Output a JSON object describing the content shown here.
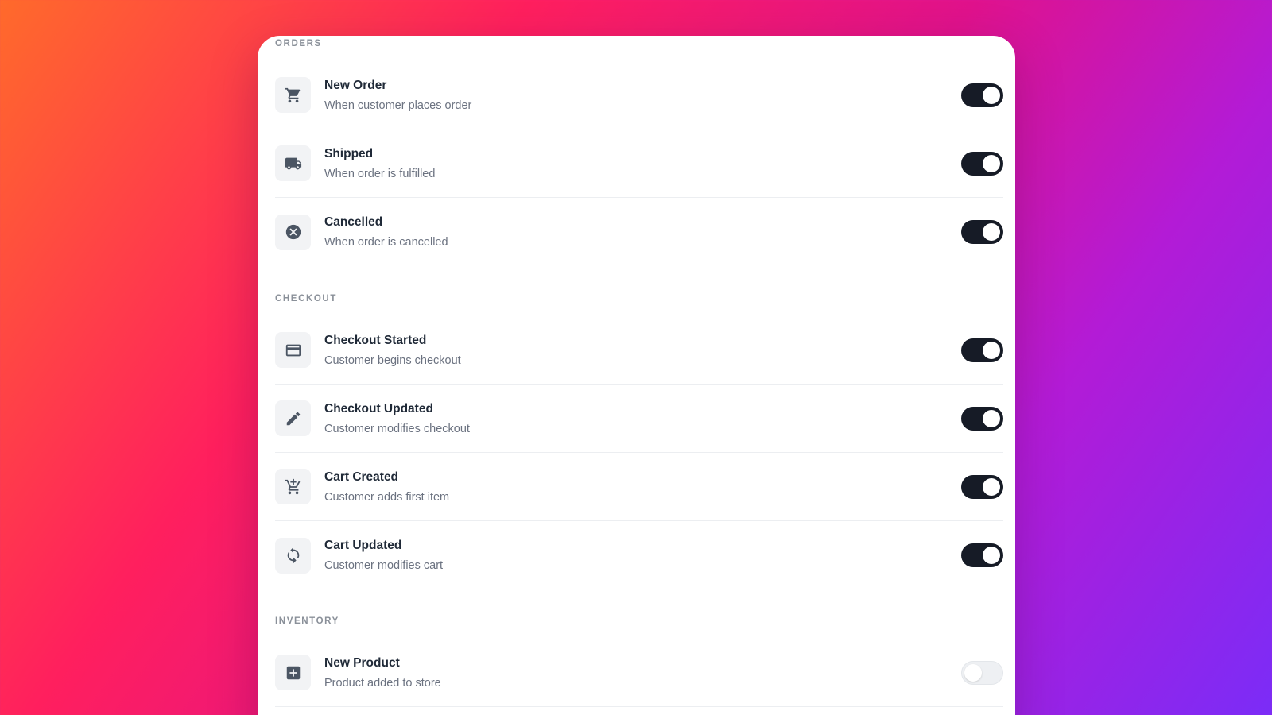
{
  "sections": [
    {
      "header": "ORDERS",
      "items": [
        {
          "title": "New Order",
          "desc": "When customer places order",
          "icon": "cart-icon",
          "enabled": true
        },
        {
          "title": "Shipped",
          "desc": "When order is fulfilled",
          "icon": "truck-icon",
          "enabled": true
        },
        {
          "title": "Cancelled",
          "desc": "When order is cancelled",
          "icon": "cancel-circle-icon",
          "enabled": true
        }
      ]
    },
    {
      "header": "CHECKOUT",
      "items": [
        {
          "title": "Checkout Started",
          "desc": "Customer begins checkout",
          "icon": "credit-card-icon",
          "enabled": true
        },
        {
          "title": "Checkout Updated",
          "desc": "Customer modifies checkout",
          "icon": "pencil-icon",
          "enabled": true
        },
        {
          "title": "Cart Created",
          "desc": "Customer adds first item",
          "icon": "cart-plus-icon",
          "enabled": true
        },
        {
          "title": "Cart Updated",
          "desc": "Customer modifies cart",
          "icon": "sync-icon",
          "enabled": true
        }
      ]
    },
    {
      "header": "INVENTORY",
      "items": [
        {
          "title": "New Product",
          "desc": "Product added to store",
          "icon": "plus-box-icon",
          "enabled": false
        }
      ]
    }
  ],
  "colors": {
    "toggle_on": "#161b26",
    "toggle_off": "#eef0f3"
  }
}
